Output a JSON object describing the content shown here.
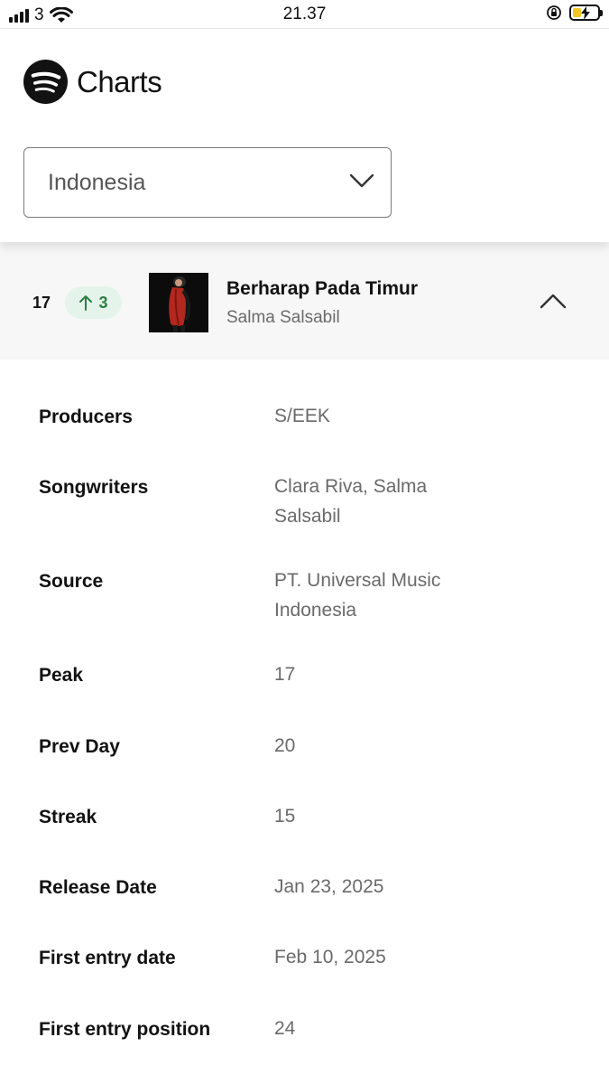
{
  "status_bar": {
    "carrier": "3",
    "time": "21.37"
  },
  "header": {
    "brand": "Charts",
    "country_select": {
      "value": "Indonesia"
    }
  },
  "track": {
    "rank": "17",
    "delta": "3",
    "delta_direction": "up",
    "title": "Berharap Pada Timur",
    "artist": "Salma Salsabil"
  },
  "details": [
    {
      "label": "Producers",
      "value": "S/EEK"
    },
    {
      "label": "Songwriters",
      "value": "Clara Riva, Salma Salsabil"
    },
    {
      "label": "Source",
      "value": "PT. Universal Music Indonesia"
    },
    {
      "label": "Peak",
      "value": "17"
    },
    {
      "label": "Prev Day",
      "value": "20"
    },
    {
      "label": "Streak",
      "value": "15"
    },
    {
      "label": "Release Date",
      "value": "Jan 23, 2025"
    },
    {
      "label": "First entry date",
      "value": "Feb 10, 2025"
    },
    {
      "label": "First entry position",
      "value": "24"
    }
  ],
  "colors": {
    "delta_bg": "#e5f4ea",
    "delta_fg": "#2e7d45",
    "battery": "#f3c623"
  },
  "icons": {
    "logo": "spotify-logo-icon",
    "select": "chevron-down-icon",
    "delta": "arrow-up-icon",
    "row": "chevron-up-icon"
  }
}
